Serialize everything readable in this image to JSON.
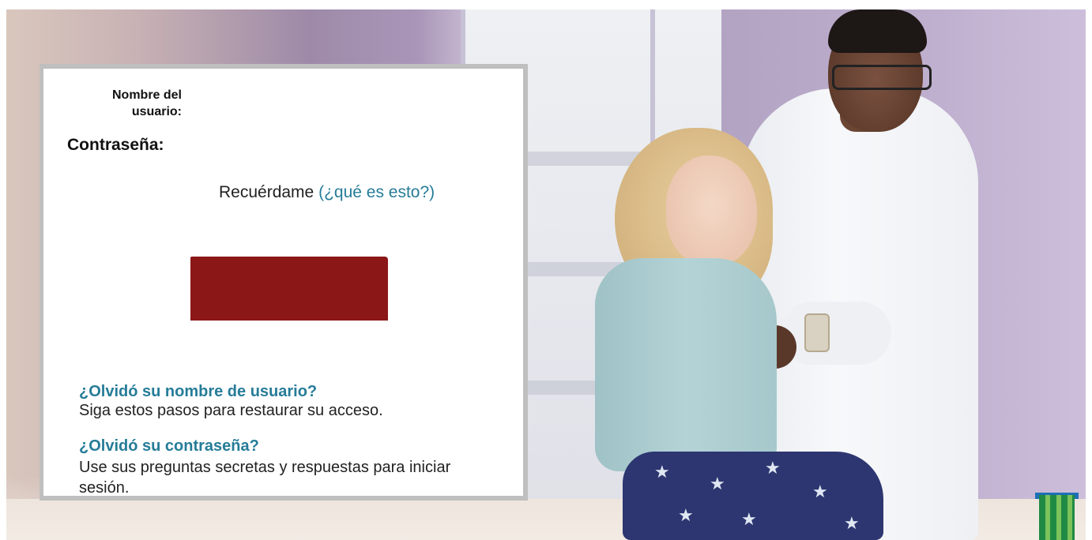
{
  "login": {
    "username_label": "Nombre del usuario:",
    "username_value": "",
    "password_label": "Contraseña:",
    "password_value": "",
    "remember_label": "Recuérdame",
    "remember_help_link": "(¿qué es esto?)",
    "remember_checked": false,
    "submit_label": ""
  },
  "help": {
    "forgot_username_link": "¿Olvidó su nombre de usuario?",
    "forgot_username_text": "Siga estos pasos para restaurar su acceso.",
    "forgot_password_link": "¿Olvidó su contraseña?",
    "forgot_password_text": "Use sus preguntas secretas y respuestas para iniciar sesión."
  },
  "colors": {
    "link": "#267c98",
    "submit_button": "#8b1717",
    "panel_border": "#bfbfbf"
  }
}
